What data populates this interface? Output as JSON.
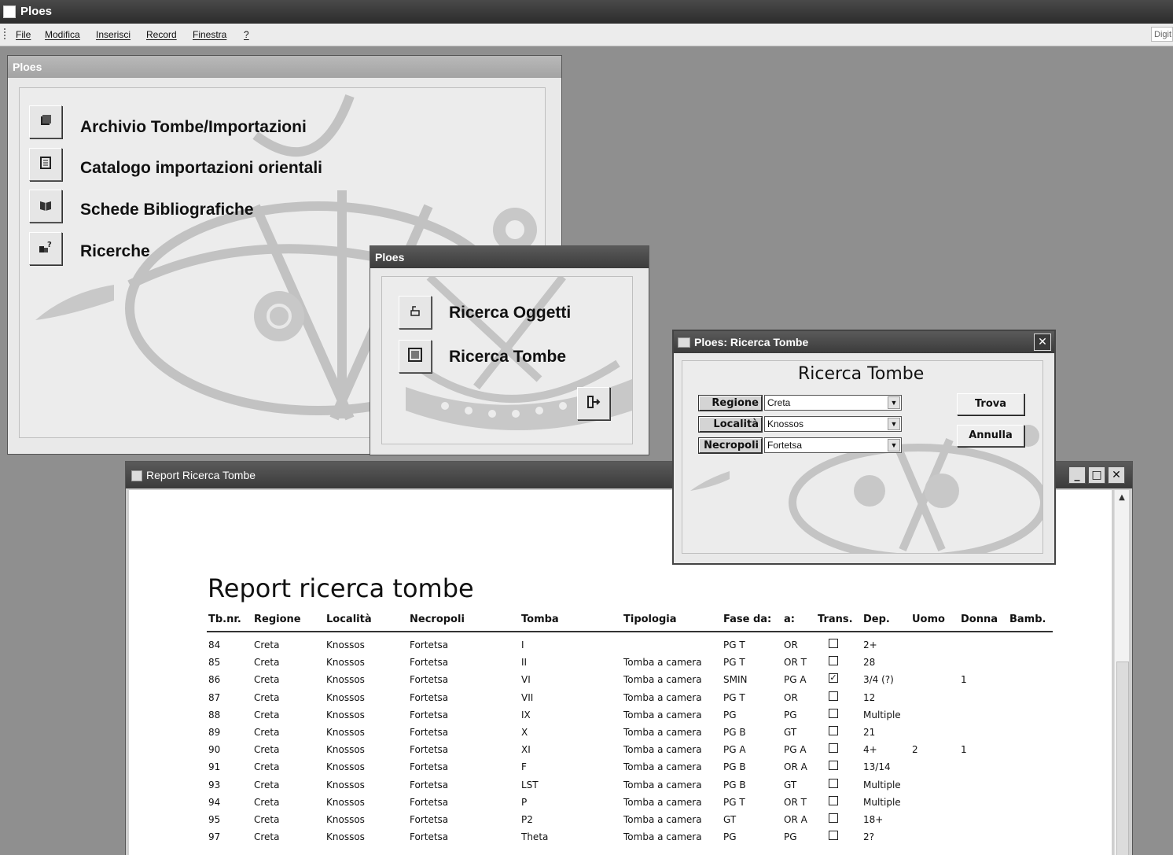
{
  "app": {
    "title": "Ploes"
  },
  "menu": {
    "items": [
      "File",
      "Modifica",
      "Inserisci",
      "Record",
      "Finestra",
      "?"
    ],
    "search_box_text": "Digit"
  },
  "main_menu": {
    "title": "Ploes",
    "items": [
      {
        "label": "Archivio Tombe/Importazioni",
        "icon": "archive-icon"
      },
      {
        "label": "Catalogo importazioni orientali",
        "icon": "catalog-icon"
      },
      {
        "label": "Schede Bibliografiche",
        "icon": "book-icon"
      },
      {
        "label": "Ricerche",
        "icon": "search-icon"
      }
    ]
  },
  "search_menu": {
    "title": "Ploes",
    "items": [
      {
        "label": "Ricerca Oggetti",
        "icon": "object-icon"
      },
      {
        "label": "Ricerca Tombe",
        "icon": "tomb-icon"
      }
    ],
    "exit_icon": "exit-icon"
  },
  "search_form": {
    "window_title": "Ploes: Ricerca Tombe",
    "title": "Ricerca Tombe",
    "fields": [
      {
        "label": "Regione",
        "value": "Creta"
      },
      {
        "label": "Località",
        "value": "Knossos"
      },
      {
        "label": "Necropoli",
        "value": "Fortetsa"
      }
    ],
    "find_button": "Trova",
    "cancel_button": "Annulla",
    "close_glyph": "✕"
  },
  "report": {
    "window_title": "Report Ricerca Tombe",
    "title": "Report ricerca tombe",
    "columns": [
      "Tb.nr.",
      "Regione",
      "Località",
      "Necropoli",
      "Tomba",
      "Tipologia",
      "Fase da:",
      "a:",
      "Trans.",
      "Dep.",
      "Uomo",
      "Donna",
      "Bamb."
    ],
    "rows": [
      [
        "84",
        "Creta",
        "Knossos",
        "Fortetsa",
        "I",
        "",
        "PG T",
        "OR",
        false,
        "2+",
        "",
        "",
        ""
      ],
      [
        "85",
        "Creta",
        "Knossos",
        "Fortetsa",
        "II",
        "Tomba a camera",
        "PG T",
        "OR T",
        false,
        "28",
        "",
        "",
        ""
      ],
      [
        "86",
        "Creta",
        "Knossos",
        "Fortetsa",
        "VI",
        "Tomba a camera",
        "SMIN",
        "PG A",
        true,
        "3/4 (?)",
        "",
        "1",
        ""
      ],
      [
        "87",
        "Creta",
        "Knossos",
        "Fortetsa",
        "VII",
        "Tomba a camera",
        "PG T",
        "OR",
        false,
        "12",
        "",
        "",
        ""
      ],
      [
        "88",
        "Creta",
        "Knossos",
        "Fortetsa",
        "IX",
        "Tomba a camera",
        "PG",
        "PG",
        false,
        "Multiple",
        "",
        "",
        ""
      ],
      [
        "89",
        "Creta",
        "Knossos",
        "Fortetsa",
        "X",
        "Tomba a camera",
        "PG B",
        "GT",
        false,
        "21",
        "",
        "",
        ""
      ],
      [
        "90",
        "Creta",
        "Knossos",
        "Fortetsa",
        "XI",
        "Tomba a camera",
        "PG A",
        "PG A",
        false,
        "4+",
        "2",
        "1",
        ""
      ],
      [
        "91",
        "Creta",
        "Knossos",
        "Fortetsa",
        "F",
        "Tomba a camera",
        "PG B",
        "OR A",
        false,
        "13/14",
        "",
        "",
        ""
      ],
      [
        "93",
        "Creta",
        "Knossos",
        "Fortetsa",
        "LST",
        "Tomba a camera",
        "PG B",
        "GT",
        false,
        "Multiple",
        "",
        "",
        ""
      ],
      [
        "94",
        "Creta",
        "Knossos",
        "Fortetsa",
        "P",
        "Tomba a camera",
        "PG T",
        "OR T",
        false,
        "Multiple",
        "",
        "",
        ""
      ],
      [
        "95",
        "Creta",
        "Knossos",
        "Fortetsa",
        "P2",
        "Tomba a camera",
        "GT",
        "OR A",
        false,
        "18+",
        "",
        "",
        ""
      ],
      [
        "97",
        "Creta",
        "Knossos",
        "Fortetsa",
        "Theta",
        "Tomba a camera",
        "PG",
        "PG",
        false,
        "2?",
        "",
        "",
        ""
      ]
    ]
  }
}
